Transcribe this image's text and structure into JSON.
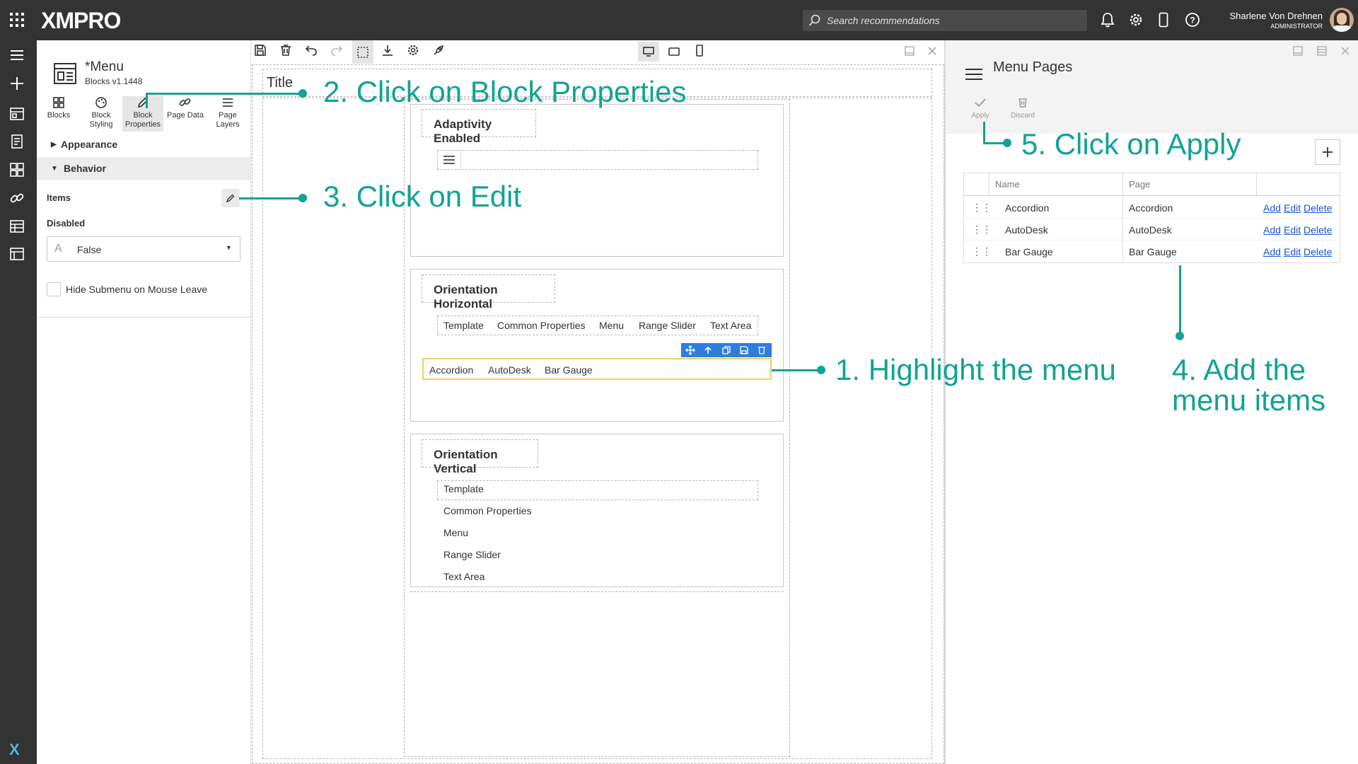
{
  "app": {
    "brand": "XMPRO"
  },
  "topbar": {
    "search_placeholder": "Search recommendations",
    "user_name": "Sharlene Von Drehnen",
    "user_role": "ADMINISTRATOR"
  },
  "properties": {
    "block_title": "*Menu",
    "block_version": "Blocks v1.1448",
    "tabs": [
      {
        "label1": "Blocks",
        "label2": ""
      },
      {
        "label1": "Block",
        "label2": "Styling"
      },
      {
        "label1": "Block",
        "label2": "Properties"
      },
      {
        "label1": "Page Data",
        "label2": ""
      },
      {
        "label1": "Page",
        "label2": "Layers"
      }
    ],
    "appearance_label": "Appearance",
    "behavior_label": "Behavior",
    "items_label": "Items",
    "disabled_label": "Disabled",
    "disabled_value": "False",
    "hide_submenu_label": "Hide Submenu on Mouse Leave"
  },
  "canvas": {
    "title_label": "Title",
    "sections": {
      "adaptivity": "Adaptivity Enabled",
      "horizontal": "Orientation Horizontal",
      "vertical": "Orientation Vertical"
    },
    "horizontal_items": [
      "Template",
      "Common Properties",
      "Menu",
      "Range Slider",
      "Text Area"
    ],
    "selected_menu_items": [
      "Accordion",
      "AutoDesk",
      "Bar Gauge"
    ],
    "vertical_items": [
      "Template",
      "Common Properties",
      "Menu",
      "Range Slider",
      "Text Area"
    ]
  },
  "menu_pages": {
    "title": "Menu Pages",
    "apply_label": "Apply",
    "discard_label": "Discard",
    "columns": [
      "Name",
      "Page"
    ],
    "rows": [
      {
        "name": "Accordion",
        "page": "Accordion"
      },
      {
        "name": "AutoDesk",
        "page": "AutoDesk"
      },
      {
        "name": "Bar Gauge",
        "page": "Bar Gauge"
      }
    ],
    "actions": {
      "add": "Add",
      "edit": "Edit",
      "delete": "Delete"
    }
  },
  "callouts": {
    "step1": "1. Highlight the menu",
    "step2": "2. Click on Block Properties",
    "step3": "3. Click on Edit",
    "step4_line1": "4. Add the",
    "step4_line2": "menu items",
    "step5": "5. Click on Apply"
  },
  "colors": {
    "accent": "#12a394",
    "topbar": "#333333",
    "selection": "#f0d060",
    "toolbar_blue": "#2e7de1",
    "link": "#1a56c8"
  }
}
